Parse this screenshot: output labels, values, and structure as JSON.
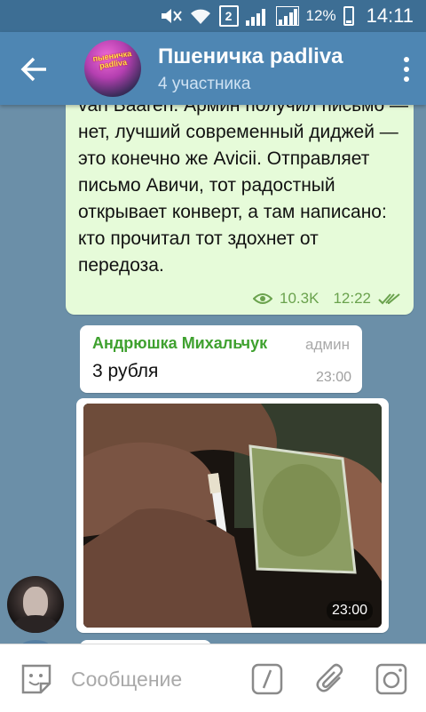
{
  "status_bar": {
    "sim_label": "2",
    "battery": "12%",
    "time": "14:11"
  },
  "header": {
    "back_icon": "arrow-left-icon",
    "avatar_logo": "пыеничка padliva",
    "title": "Пшеничка padliva",
    "subtitle": "4 участника",
    "menu_icon": "dots-vertical-icon"
  },
  "messages": {
    "outgoing": {
      "text": "van Baaren. Армин получил письмо — нет, лучший современный диджей — это конечно же Avicii. Отправляет письмо Авичи, тот радостный открывает конверт, а там написано: кто прочитал тот здохнет от передоза.",
      "views": "10.3K",
      "time": "12:22"
    },
    "incoming_text": {
      "sender": "Андрюшка Михальчук",
      "role": "админ",
      "text": "3 рубля",
      "time": "23:00"
    },
    "incoming_photo": {
      "time": "23:00"
    }
  },
  "input_bar": {
    "placeholder": "Сообщение",
    "icons": [
      "sticker-icon",
      "slash-command-icon",
      "paperclip-icon",
      "camera-icon"
    ]
  },
  "colors": {
    "header": "#4e86b3",
    "status_bar": "#3d6e94",
    "outgoing_bubble": "#e6fbd9",
    "sender_name": "#3fa12f",
    "background": "#6b8fa8"
  }
}
